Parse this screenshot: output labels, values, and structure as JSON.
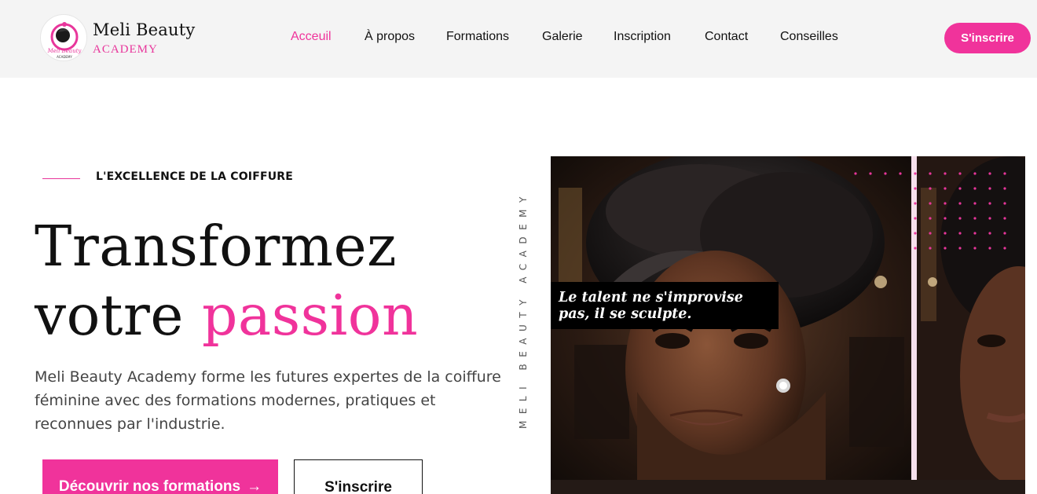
{
  "brand": {
    "name": "Meli Beauty",
    "subtitle": "ACADEMY",
    "logo_text": "Meli Beauty",
    "logo_subtext": "ACADEMY"
  },
  "nav": {
    "items": [
      {
        "label": "Acceuil",
        "active": true
      },
      {
        "label": "À propos",
        "active": false
      },
      {
        "label": "Formations",
        "active": false
      },
      {
        "label": "Galerie",
        "active": false
      },
      {
        "label": "Inscription",
        "active": false
      },
      {
        "label": "Contact",
        "active": false
      },
      {
        "label": "Conseilles",
        "active": false
      }
    ],
    "cta_label": "S'inscrire"
  },
  "hero": {
    "eyebrow": "L'EXCELLENCE DE LA COIFFURE",
    "headline_line1": "Transformez",
    "headline_line2_plain": "votre",
    "headline_line2_accent": "passion",
    "description": "Meli Beauty Academy forme les futures expertes de la coiffure féminine avec des formations modernes, pratiques et reconnues par l'industrie.",
    "primary_button": "Découvrir nos formations",
    "primary_arrow": "→",
    "secondary_button": "S'inscrire",
    "vertical_text": "MELI BEAUTY ACADEMY",
    "quote": "Le talent ne s'improvise pas, il se sculpte."
  },
  "colors": {
    "accent": "#f0339b",
    "header_bg": "#f4f4f4",
    "text": "#111111"
  }
}
